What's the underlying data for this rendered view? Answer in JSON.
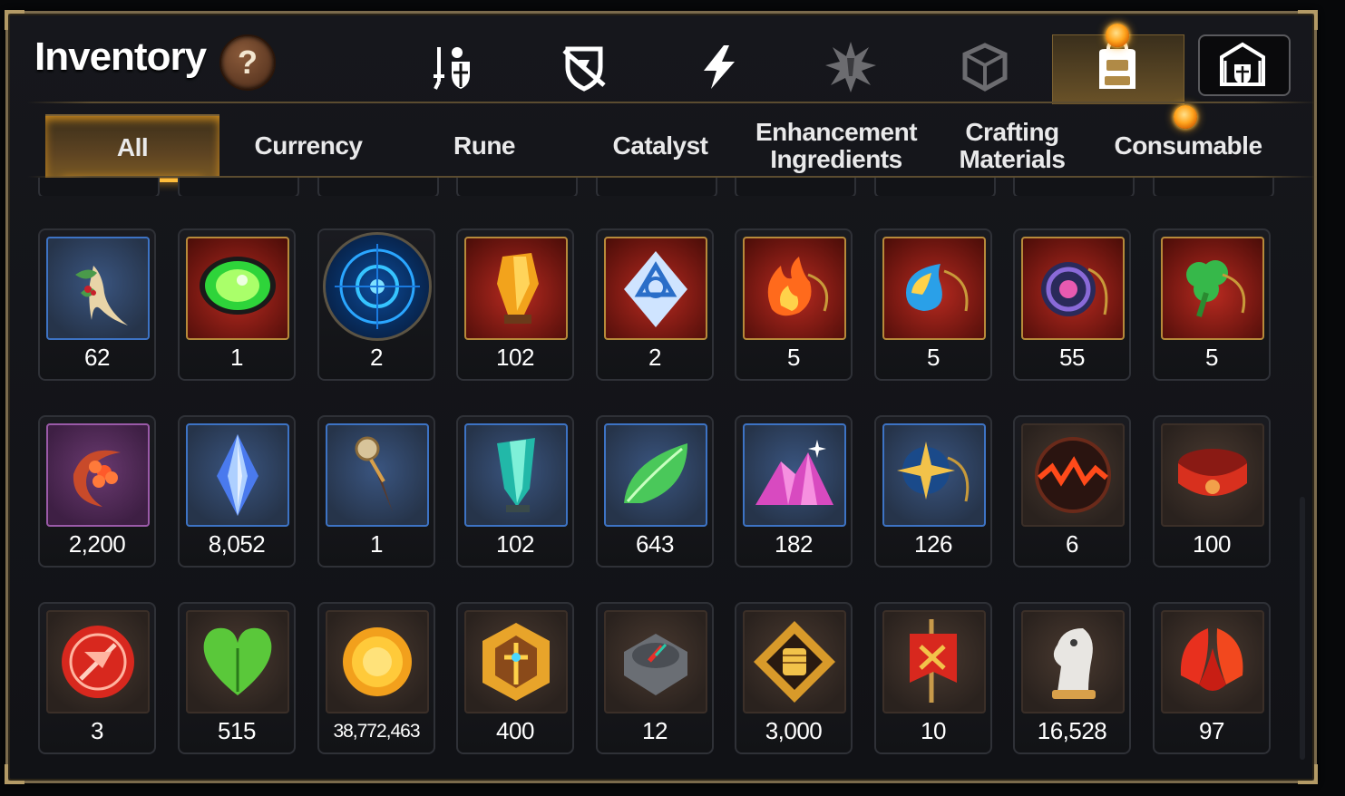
{
  "header": {
    "title": "Inventory",
    "help_label": "?"
  },
  "category_icons": [
    {
      "icon": "knight-shield-icon",
      "active": false
    },
    {
      "icon": "broken-shield-icon",
      "active": false
    },
    {
      "icon": "lightning-icon",
      "active": false
    },
    {
      "icon": "burst-icon",
      "active": false
    },
    {
      "icon": "cube-icon",
      "active": false
    },
    {
      "icon": "backpack-icon",
      "active": true
    },
    {
      "icon": "fortress-icon",
      "active": false
    }
  ],
  "tabs": [
    {
      "label": "All",
      "active": true
    },
    {
      "label": "Currency"
    },
    {
      "label": "Rune"
    },
    {
      "label": "Catalyst"
    },
    {
      "label": "Enhancement Ingredients"
    },
    {
      "label": "Crafting Materials"
    },
    {
      "label": "Consumable"
    }
  ],
  "items": [
    [
      {
        "icon": "ginseng-root-icon",
        "count": "62"
      },
      {
        "icon": "green-gem-icon",
        "count": "1"
      },
      {
        "icon": "blue-rune-orb-icon",
        "count": "2"
      },
      {
        "icon": "amber-crystal-icon",
        "count": "102"
      },
      {
        "icon": "triquetra-crystal-icon",
        "count": "2"
      },
      {
        "icon": "fire-pendant-icon",
        "count": "5"
      },
      {
        "icon": "water-pendant-icon",
        "count": "5"
      },
      {
        "icon": "galaxy-pendant-icon",
        "count": "55"
      },
      {
        "icon": "clover-pendant-icon",
        "count": "5"
      }
    ],
    [
      {
        "icon": "crescent-flower-icon",
        "count": "2,200"
      },
      {
        "icon": "blue-crystal-icon",
        "count": "8,052"
      },
      {
        "icon": "compass-pendulum-icon",
        "count": "1"
      },
      {
        "icon": "teal-crystal-icon",
        "count": "102"
      },
      {
        "icon": "green-leaf-icon",
        "count": "643"
      },
      {
        "icon": "pink-ore-icon",
        "count": "182"
      },
      {
        "icon": "star-pendant-icon",
        "count": "126"
      },
      {
        "icon": "lava-orb-icon",
        "count": "6"
      },
      {
        "icon": "red-bracelet-icon",
        "count": "100"
      }
    ],
    [
      {
        "icon": "red-seal-icon",
        "count": "3"
      },
      {
        "icon": "green-heart-icon",
        "count": "515"
      },
      {
        "icon": "gold-sun-coin-icon",
        "count": "38,772,463"
      },
      {
        "icon": "gold-hex-emblem-icon",
        "count": "400"
      },
      {
        "icon": "stone-compass-icon",
        "count": "12"
      },
      {
        "icon": "fist-emblem-icon",
        "count": "3,000"
      },
      {
        "icon": "red-banner-icon",
        "count": "10"
      },
      {
        "icon": "chess-knight-icon",
        "count": "16,528"
      },
      {
        "icon": "red-leaf-icon",
        "count": "97"
      }
    ]
  ],
  "colors": {
    "accent_gold": "#ffbd3b",
    "frame": "#7a6a4c",
    "panel": "#16171c"
  }
}
